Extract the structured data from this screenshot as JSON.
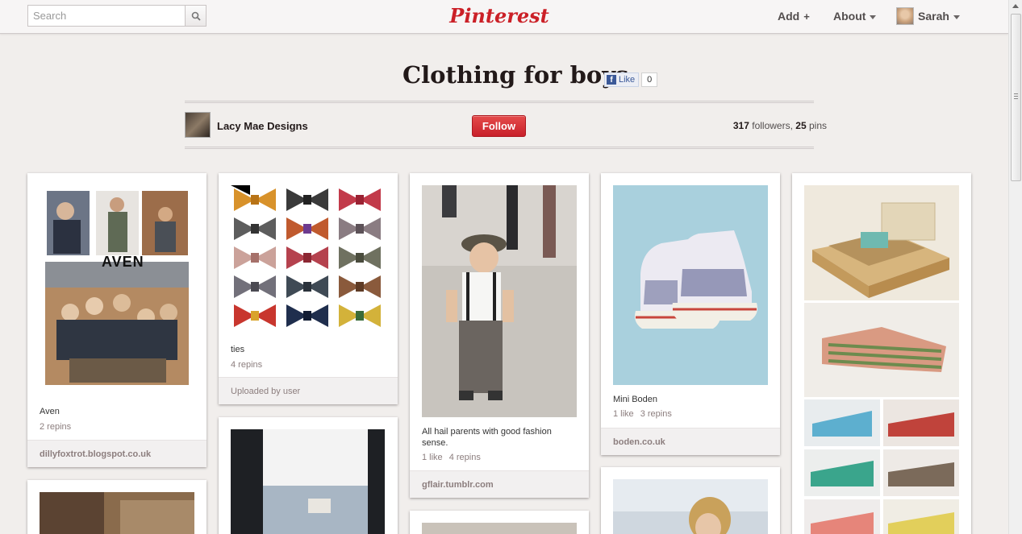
{
  "header": {
    "search_placeholder": "Search",
    "logo": "Pinterest",
    "nav": {
      "add": "Add",
      "about": "About",
      "user": "Sarah"
    }
  },
  "board": {
    "title": "Clothing for boys",
    "fb_like": "Like",
    "fb_count": "0",
    "owner": "Lacy Mae Designs",
    "follow": "Follow",
    "followers_count": "317",
    "followers_label": "followers",
    "pins_count": "25",
    "pins_label": "pins"
  },
  "pins": [
    {
      "desc": "Aven",
      "stats": [
        "2 repins"
      ],
      "source": "dillyfoxtrot.blogspot.co.uk"
    },
    {
      "desc": "ties",
      "stats": [
        "4 repins"
      ],
      "source": "Uploaded by user"
    },
    {
      "desc": "All hail parents with good fashion sense.",
      "stats": [
        "1 like",
        "4 repins"
      ],
      "source": "gflair.tumblr.com"
    },
    {
      "desc": "Mini Boden",
      "stats": [
        "1 like",
        "3 repins"
      ],
      "source": "boden.co.uk"
    }
  ],
  "image_texts": {
    "aven_logo": "AVEN"
  },
  "colors": {
    "brand_red": "#cb2027",
    "follow_red": "#d5262f",
    "background": "#f1eeec"
  }
}
